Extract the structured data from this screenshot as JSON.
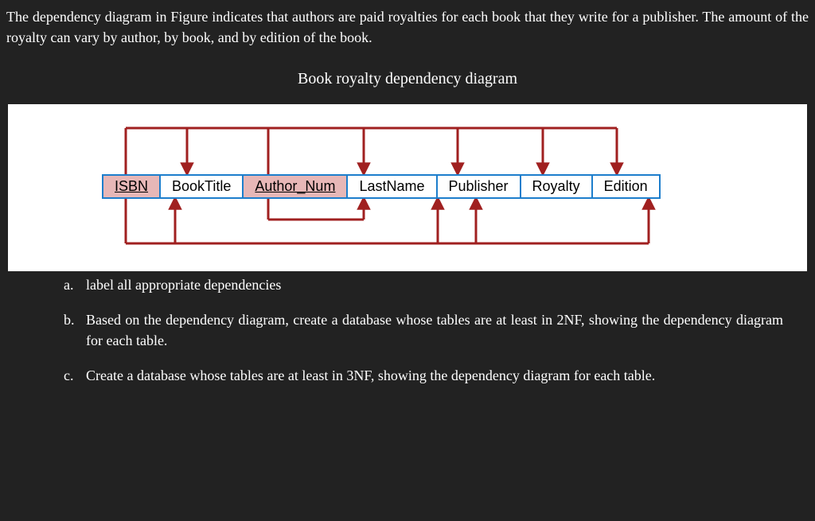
{
  "intro": "The dependency diagram in Figure indicates that authors are paid royalties for each book that they write for a publisher.  The amount of the royalty can vary by author, by book, and by edition of the book.",
  "figure_title": "Book royalty dependency diagram",
  "diagram": {
    "attributes": [
      {
        "name": "ISBN",
        "key": true
      },
      {
        "name": "BookTitle",
        "key": false
      },
      {
        "name": "Author_Num",
        "key": true
      },
      {
        "name": "LastName",
        "key": false
      },
      {
        "name": "Publisher",
        "key": false
      },
      {
        "name": "Royalty",
        "key": false
      },
      {
        "name": "Edition",
        "key": false
      }
    ],
    "dependencies_top": {
      "determinant": [
        "ISBN",
        "Author_Num"
      ],
      "determines": [
        "BookTitle",
        "LastName",
        "Publisher",
        "Royalty",
        "Edition"
      ]
    },
    "dependencies_bottom_small": {
      "determinant": [
        "Author_Num"
      ],
      "determines": [
        "LastName"
      ]
    },
    "dependencies_bottom_large": {
      "determinant": [
        "ISBN"
      ],
      "determines": [
        "BookTitle",
        "Publisher",
        "Royalty",
        "Edition"
      ]
    }
  },
  "questions": {
    "a": "label all appropriate dependencies",
    "b": "Based on the dependency diagram, create a database whose tables are at least in 2NF, showing the dependency diagram for each table.",
    "c": "Create a database whose tables are at least in 3NF, showing the dependency diagram for each table."
  },
  "labels": {
    "a": "a.",
    "b": "b.",
    "c": "c."
  }
}
